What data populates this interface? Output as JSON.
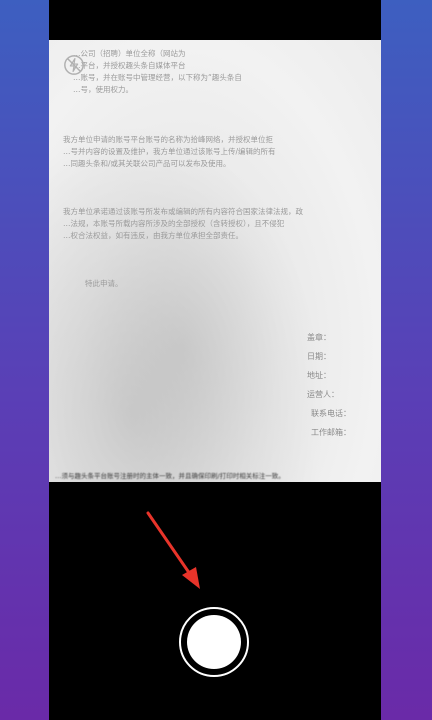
{
  "camera": {
    "flash_icon": "flash-off-icon",
    "shutter_icon": "shutter-icon",
    "annotation_icon": "red-arrow-icon",
    "accent": "#e8342a"
  },
  "document": {
    "para1": [
      "…公司（招聘）单位全称（网站为",
      "…平台，并授权趣头条自媒体平台",
      "…账号，并在账号中管理经营，以下称为“趣头条自",
      "…号，使用权力。"
    ],
    "para2": [
      "我方单位申请的账号平台账号的名称为拾峰网络，并授权单位拒",
      "…号并内容的设置及维护，我方单位通过该账号上传/编辑的所有",
      "…同趣头条和/或其关联公司产品可以发布及使用。"
    ],
    "para3": [
      "我方单位承诺通过该账号所发布或编辑的所有内容符合国家法律法规，政",
      "…法规，本账号所载内容所涉及的全部授权（含转授权），且不侵犯",
      "…权合法权益，如有违反，由我方单位承担全部责任。"
    ],
    "para4": "特此申请。",
    "signature": [
      "盖章：",
      "日期：",
      "地址：",
      "运营人：",
      "联系电话：",
      "工作邮箱："
    ],
    "footer": "…须与趣头条平台账号注册时的主体一致，并且确保印刷/打印时相关标注一致。"
  }
}
